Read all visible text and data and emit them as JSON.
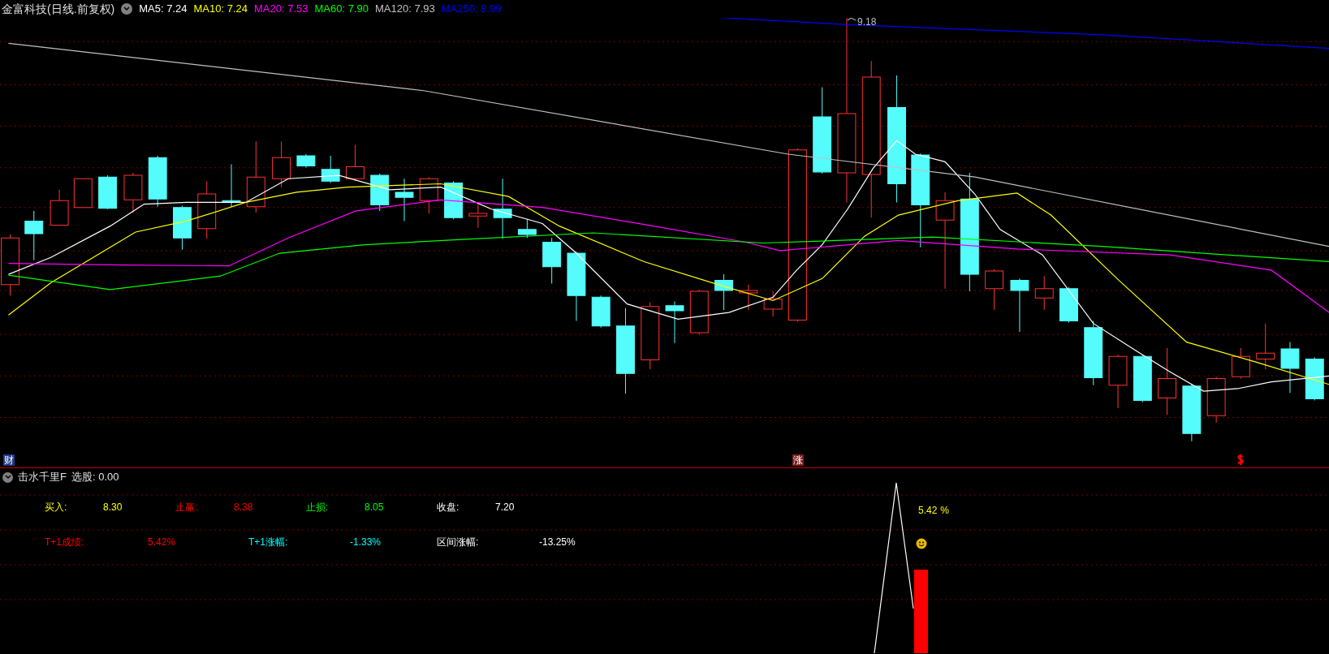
{
  "header": {
    "title": "金富科技(日线.前复权)",
    "indicators": [
      {
        "label": "MA5: 7.24",
        "color": "#ffffff"
      },
      {
        "label": "MA10: 7.24",
        "color": "#ffff00"
      },
      {
        "label": "MA20: 7.53",
        "color": "#ff00ff"
      },
      {
        "label": "MA60: 7.90",
        "color": "#00ff00"
      },
      {
        "label": "MA120: 7.93",
        "color": "#c0c0c0"
      },
      {
        "label": "MA250: 8.99",
        "color": "#0000ff"
      }
    ]
  },
  "main_chart": {
    "high_label": "9.18",
    "markers": [
      {
        "kind": "badge",
        "text": "财",
        "color": "#1e3a8a"
      },
      {
        "kind": "badge",
        "text": "涨",
        "color": "#7f1d1d"
      },
      {
        "kind": "icon",
        "color": "#ff0000"
      }
    ]
  },
  "indicator_panel": {
    "title": "击水千里F",
    "reading": "选股: 0.00",
    "stats": [
      {
        "label": "买入:",
        "value": "8.30",
        "color": "#ffff00"
      },
      {
        "label": "止赢:",
        "value": "8.38",
        "color": "#ff0000"
      },
      {
        "label": "止损:",
        "value": "8.05",
        "color": "#00ff00"
      },
      {
        "label": "收盘:",
        "value": "7.20",
        "color": "#ffffff"
      },
      {
        "label": "T+1成绩:",
        "value": "5.42%",
        "color": "#ff0000"
      },
      {
        "label": "T+1涨幅:",
        "value": "-1.33%",
        "color": "#00ffff"
      },
      {
        "label": "区间涨幅:",
        "value": "-13.25%",
        "color": "#ffffff"
      }
    ],
    "signal": {
      "value": "5.42",
      "unit": "%"
    }
  }
}
